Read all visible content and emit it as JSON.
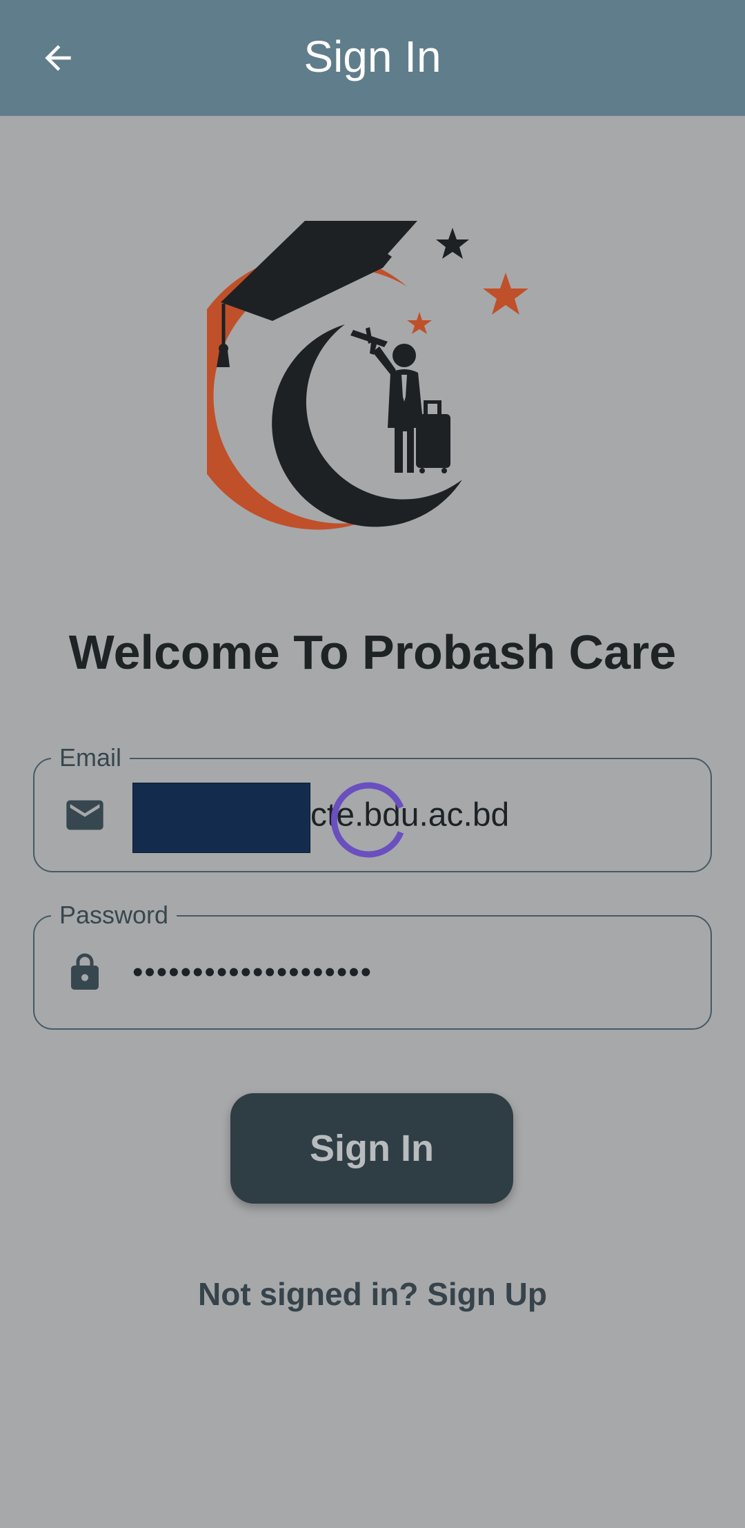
{
  "appbar": {
    "title": "Sign In",
    "back_icon": "arrow-left-icon",
    "background": "#607d8b"
  },
  "logo": {
    "icons": [
      "graduation-cap-icon",
      "traveler-with-luggage-icon",
      "star-icon"
    ],
    "colors": {
      "dark": "#1e2124",
      "accent": "#c0502a"
    }
  },
  "welcome": {
    "title": "Welcome To Probash Care"
  },
  "form": {
    "email": {
      "label": "Email",
      "icon": "mail-icon",
      "value_visible_suffix": "cte.bdu.ac.bd"
    },
    "password": {
      "label": "Password",
      "icon": "lock-icon",
      "value_masked": "••••••••••••••••••••"
    },
    "submit_label": "Sign In"
  },
  "loading": {
    "icon": "loading-spinner-icon",
    "color": "#6a4fc0"
  },
  "signup": {
    "text": "Not signed in? Sign Up"
  },
  "colors": {
    "background": "#a7a8aa",
    "button": "#2f3d45",
    "redaction": "#132c4e"
  }
}
